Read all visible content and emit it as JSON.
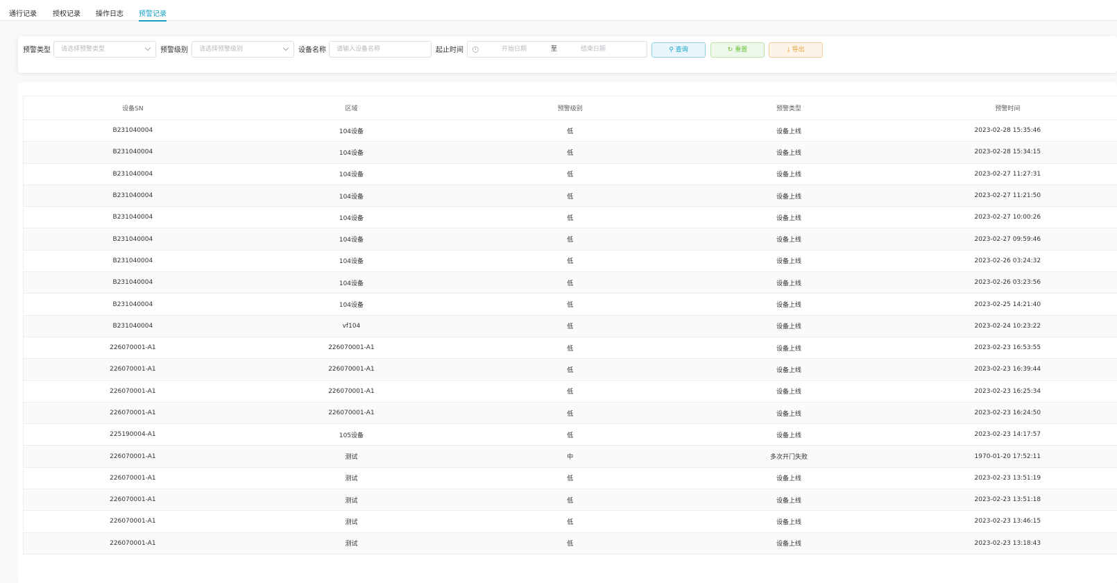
{
  "tabs": [
    {
      "label": "通行记录"
    },
    {
      "label": "授权记录"
    },
    {
      "label": "操作日志"
    },
    {
      "label": "预警记录"
    }
  ],
  "filters": {
    "warning_type": {
      "label": "预警类型",
      "placeholder": "请选择预警类型"
    },
    "warning_level": {
      "label": "预警级别",
      "placeholder": "请选择预警级别"
    },
    "device_name": {
      "label": "设备名称",
      "placeholder": "请输入设备名称"
    },
    "time_range": {
      "label": "起止时间",
      "start_placeholder": "开始日期",
      "separator": "至",
      "end_placeholder": "结束日期"
    }
  },
  "buttons": {
    "query": "查询",
    "reset": "重置",
    "export": "导出"
  },
  "table": {
    "columns": [
      "设备SN",
      "区域",
      "预警级别",
      "预警类型",
      "预警时间"
    ],
    "rows": [
      [
        "B231040004",
        "104设备",
        "低",
        "设备上线",
        "2023-02-28 15:35:46"
      ],
      [
        "B231040004",
        "104设备",
        "低",
        "设备上线",
        "2023-02-28 15:34:15"
      ],
      [
        "B231040004",
        "104设备",
        "低",
        "设备上线",
        "2023-02-27 11:27:31"
      ],
      [
        "B231040004",
        "104设备",
        "低",
        "设备上线",
        "2023-02-27 11:21:50"
      ],
      [
        "B231040004",
        "104设备",
        "低",
        "设备上线",
        "2023-02-27 10:00:26"
      ],
      [
        "B231040004",
        "104设备",
        "低",
        "设备上线",
        "2023-02-27 09:59:46"
      ],
      [
        "B231040004",
        "104设备",
        "低",
        "设备上线",
        "2023-02-26 03:24:32"
      ],
      [
        "B231040004",
        "104设备",
        "低",
        "设备上线",
        "2023-02-26 03:23:56"
      ],
      [
        "B231040004",
        "104设备",
        "低",
        "设备上线",
        "2023-02-25 14:21:40"
      ],
      [
        "B231040004",
        "vf104",
        "低",
        "设备上线",
        "2023-02-24 10:23:22"
      ],
      [
        "226070001-A1",
        "226070001-A1",
        "低",
        "设备上线",
        "2023-02-23 16:53:55"
      ],
      [
        "226070001-A1",
        "226070001-A1",
        "低",
        "设备上线",
        "2023-02-23 16:39:44"
      ],
      [
        "226070001-A1",
        "226070001-A1",
        "低",
        "设备上线",
        "2023-02-23 16:25:34"
      ],
      [
        "226070001-A1",
        "226070001-A1",
        "低",
        "设备上线",
        "2023-02-23 16:24:50"
      ],
      [
        "225190004-A1",
        "105设备",
        "低",
        "设备上线",
        "2023-02-23 14:17:57"
      ],
      [
        "226070001-A1",
        "测试",
        "中",
        "多次开门失败",
        "1970-01-20 17:52:11"
      ],
      [
        "226070001-A1",
        "测试",
        "低",
        "设备上线",
        "2023-02-23 13:51:19"
      ],
      [
        "226070001-A1",
        "测试",
        "低",
        "设备上线",
        "2023-02-23 13:51:18"
      ],
      [
        "226070001-A1",
        "测试",
        "低",
        "设备上线",
        "2023-02-23 13:46:15"
      ],
      [
        "226070001-A1",
        "测试",
        "低",
        "设备上线",
        "2023-02-23 13:18:43"
      ]
    ]
  }
}
